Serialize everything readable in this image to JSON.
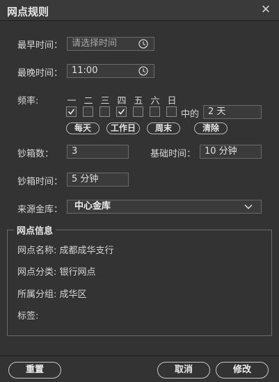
{
  "window": {
    "title": "网点规则",
    "close_icon": "close-icon"
  },
  "form": {
    "earliest_time": {
      "label": "最早时间：",
      "placeholder": "请选择时间"
    },
    "latest_time": {
      "label": "最晚时间：",
      "value": "11:00"
    },
    "frequency": {
      "label": "频率:",
      "days": [
        "一",
        "二",
        "三",
        "四",
        "五",
        "六",
        "日"
      ],
      "checked": [
        true,
        false,
        false,
        true,
        false,
        false,
        false
      ],
      "of_label": "中的",
      "of_value": "2 天",
      "presets": [
        "每天",
        "工作日",
        "周末",
        "清除"
      ]
    },
    "box_count": {
      "label": "钞箱数：",
      "value": "3"
    },
    "base_time": {
      "label": "基础时间：",
      "value": "10 分钟"
    },
    "box_time": {
      "label": "钞箱时间：",
      "value": "5 分钟"
    },
    "source_vault": {
      "label": "来源金库：",
      "value": "中心金库"
    }
  },
  "info": {
    "title": "网点信息",
    "name": "网点名称: 成都成华支行",
    "category": "网点分类: 银行网点",
    "group": "所属分组: 成华区",
    "tags": "标签:"
  },
  "buttons": {
    "reset": "重置",
    "cancel": "取消",
    "modify": "修改"
  }
}
